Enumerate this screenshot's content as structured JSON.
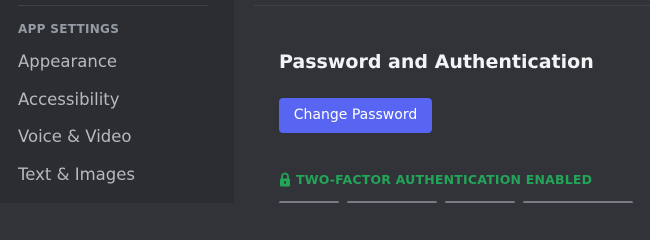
{
  "sidebar": {
    "section_header": "APP SETTINGS",
    "items": [
      {
        "label": "Appearance"
      },
      {
        "label": "Accessibility"
      },
      {
        "label": "Voice & Video"
      },
      {
        "label": "Text & Images"
      }
    ]
  },
  "main": {
    "title": "Password and Authentication",
    "change_password_label": "Change Password",
    "two_factor_status": "TWO-FACTOR AUTHENTICATION ENABLED",
    "two_factor_icon": "lock-icon"
  },
  "colors": {
    "accent": "#5865f2",
    "success": "#23a559",
    "sidebar_bg": "#2b2d31",
    "main_bg": "#313338"
  }
}
